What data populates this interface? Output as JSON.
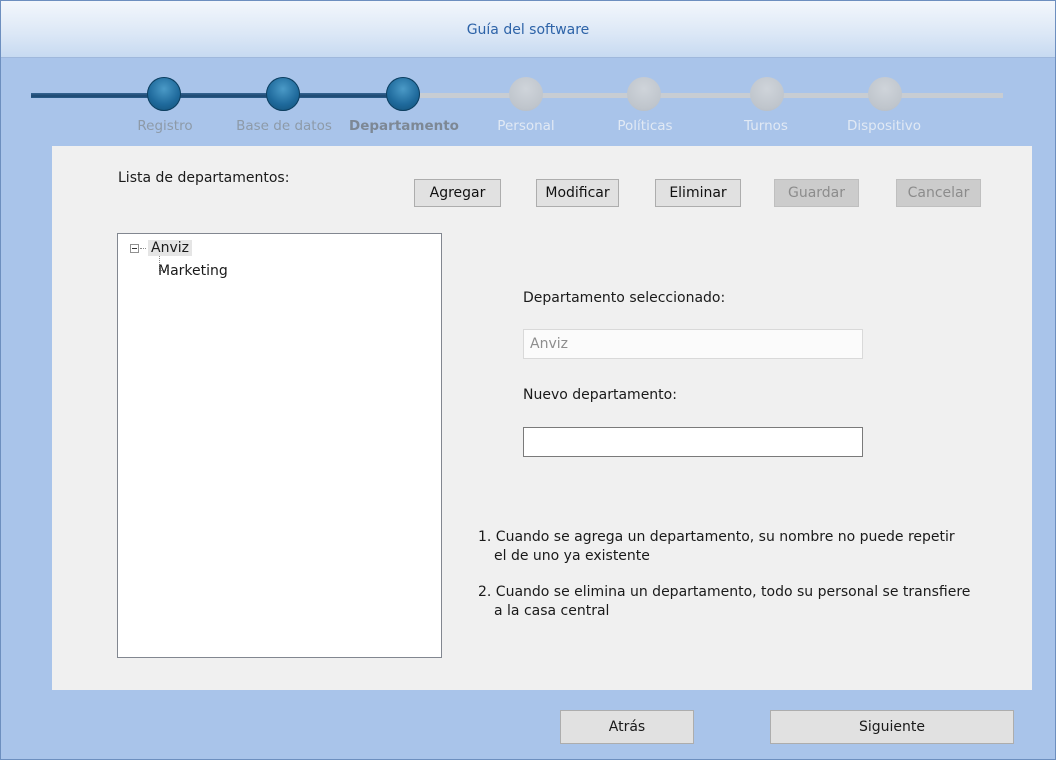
{
  "window": {
    "title": "Guía del software"
  },
  "steps": [
    {
      "label": "Registro",
      "state": "done"
    },
    {
      "label": "Base de datos",
      "state": "done"
    },
    {
      "label": "Departamento",
      "state": "current"
    },
    {
      "label": "Personal",
      "state": "todo"
    },
    {
      "label": "Políticas",
      "state": "todo"
    },
    {
      "label": "Turnos",
      "state": "todo"
    },
    {
      "label": "Dispositivo",
      "state": "todo"
    }
  ],
  "list": {
    "title": "Lista de departamentos:",
    "tree": {
      "root": "Anviz",
      "children": [
        "Marketing"
      ]
    }
  },
  "toolbar": {
    "add": "Agregar",
    "modify": "Modificar",
    "delete": "Eliminar",
    "save": "Guardar",
    "cancel": "Cancelar"
  },
  "form": {
    "selected_label": "Departamento seleccionado:",
    "selected_value": "Anviz",
    "new_label": "Nuevo departamento:",
    "new_value": ""
  },
  "notes": [
    "1. Cuando se agrega un departamento, su nombre no puede repetir el de uno ya existente",
    "2. Cuando se elimina un departamento, todo su personal se transfiere a la casa central"
  ],
  "notes_lines": [
    [
      "1. Cuando se agrega un departamento, su nombre no puede repetir",
      "el de uno ya existente"
    ],
    [
      "2. Cuando se elimina un departamento, todo su personal se transfiere",
      "a la casa central"
    ]
  ],
  "footer": {
    "back": "Atrás",
    "next": "Siguiente"
  },
  "colors": {
    "accent": "#2d63a8",
    "step_done": "#1f6a9c",
    "step_todo": "#bfc5cc",
    "background": "#a9c4ea"
  }
}
